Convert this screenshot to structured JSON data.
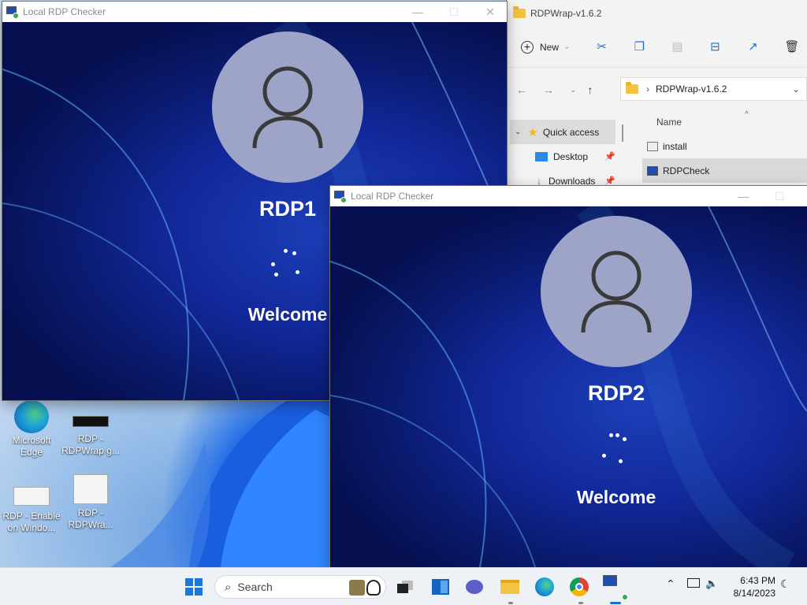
{
  "desktop": {
    "icons": [
      {
        "label": "Microsoft Edge",
        "line1": "Microsoft",
        "line2": "Edge"
      },
      {
        "label": "RDP - RDPWrap g...",
        "line1": "RDP -",
        "line2": "RDPWrap g..."
      },
      {
        "label": "RDP - Enable on Windo...",
        "line1": "RDP - Enable",
        "line2": "on Windo..."
      },
      {
        "label": "RDP - RDPWra...",
        "line1": "RDP -",
        "line2": "RDPWra..."
      }
    ]
  },
  "rdp_window_1": {
    "title": "Local RDP Checker",
    "username": "RDP1",
    "status": "Welcome"
  },
  "rdp_window_2": {
    "title": "Local RDP Checker",
    "username": "RDP2",
    "status": "Welcome"
  },
  "explorer": {
    "title": "RDPWrap-v1.6.2",
    "new_label": "New",
    "address": "RDPWrap-v1.6.2",
    "column_name": "Name",
    "nav_items": [
      {
        "label": "Quick access",
        "icon": "star-icon"
      },
      {
        "label": "Desktop",
        "icon": "desktop-icon"
      },
      {
        "label": "Downloads",
        "icon": "download-icon"
      }
    ],
    "files": [
      {
        "name": "install"
      },
      {
        "name": "RDPCheck"
      }
    ]
  },
  "taskbar": {
    "search_label": "Search",
    "time": "6:43 PM",
    "date": "8/14/2023"
  },
  "colors": {
    "avatar": "#9ea4c8",
    "wallpaper_dark": "#0a1a6e",
    "accent": "#1a6fd1"
  }
}
